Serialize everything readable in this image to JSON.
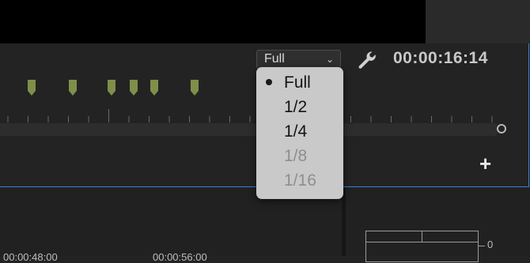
{
  "toolbar": {
    "resolution_value": "Full",
    "timecode": "00:00:16:14"
  },
  "resolution_menu": {
    "items": [
      {
        "label": "Full",
        "selected": true,
        "enabled": true
      },
      {
        "label": "1/2",
        "selected": false,
        "enabled": true
      },
      {
        "label": "1/4",
        "selected": false,
        "enabled": true
      },
      {
        "label": "1/8",
        "selected": false,
        "enabled": false
      },
      {
        "label": "1/16",
        "selected": false,
        "enabled": false
      }
    ]
  },
  "markers": {
    "count": 6,
    "color": "#7f8f4a"
  },
  "buttons": {
    "add_label": "+"
  },
  "audio_meter": {
    "zero_label": "0"
  },
  "lower_timeline": {
    "left_timecode": "00:00:48:00",
    "right_timecode": "00:00:56:00"
  },
  "colors": {
    "accent_outline": "#3f7ed8",
    "panel_bg": "#232323",
    "menu_bg": "#c9c9c9"
  },
  "icons": {
    "wrench": "wrench-icon",
    "chevron": "chevron-down-icon",
    "playhead": "playhead-circle-icon",
    "add": "plus-icon"
  }
}
